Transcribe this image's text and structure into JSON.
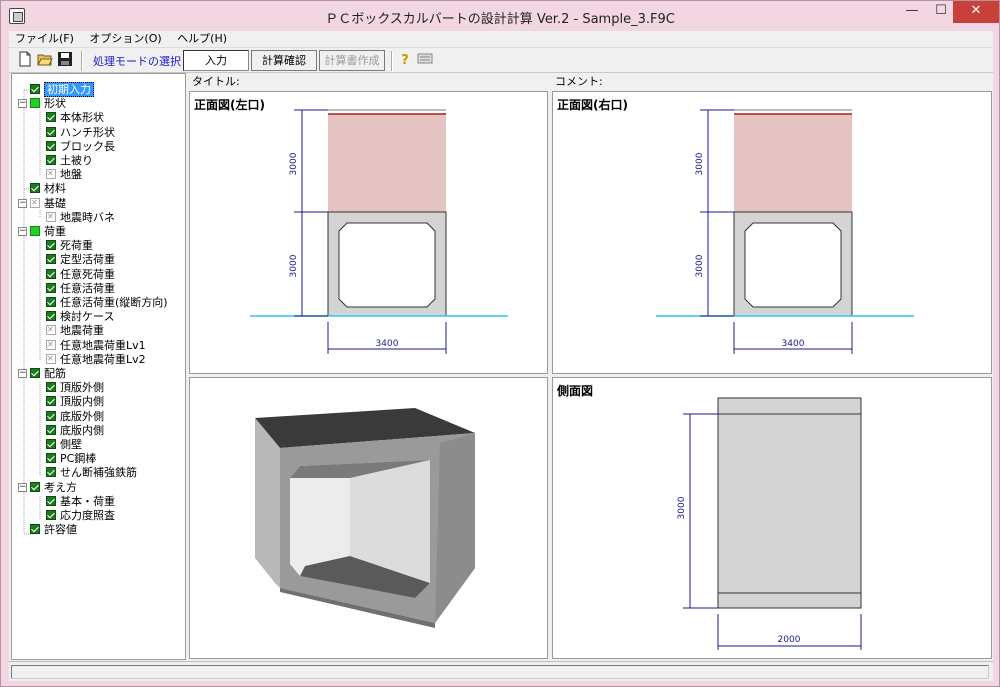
{
  "window": {
    "title": "ＰＣボックスカルバートの設計計算 Ver.2 - Sample_3.F9C",
    "min": "—",
    "max": "☐",
    "close": "✕"
  },
  "menu": [
    "ファイル(F)",
    "オプション(O)",
    "ヘルプ(H)"
  ],
  "toolbar": {
    "mode_label": "処理モードの選択",
    "input_btn": "入力",
    "calc_check_btn": "計算確認",
    "report_btn": "計算書作成",
    "help_glyph": "?"
  },
  "headers": {
    "title_label": "タイトル:",
    "comment_label": "コメント:"
  },
  "tree": [
    {
      "label": "初期入力",
      "state": "on",
      "level": 0,
      "selected": true
    },
    {
      "label": "形状",
      "state": "part",
      "level": 0,
      "expander": "−"
    },
    {
      "label": "本体形状",
      "state": "on",
      "level": 1
    },
    {
      "label": "ハンチ形状",
      "state": "on",
      "level": 1
    },
    {
      "label": "ブロック長",
      "state": "on",
      "level": 1
    },
    {
      "label": "土被り",
      "state": "on",
      "level": 1
    },
    {
      "label": "地盤",
      "state": "off",
      "level": 1
    },
    {
      "label": "材料",
      "state": "on",
      "level": 0
    },
    {
      "label": "基礎",
      "state": "off",
      "level": 0,
      "expander": "−"
    },
    {
      "label": "地震時バネ",
      "state": "off",
      "level": 1
    },
    {
      "label": "荷重",
      "state": "part",
      "level": 0,
      "expander": "−"
    },
    {
      "label": "死荷重",
      "state": "on",
      "level": 1
    },
    {
      "label": "定型活荷重",
      "state": "on",
      "level": 1
    },
    {
      "label": "任意死荷重",
      "state": "on",
      "level": 1
    },
    {
      "label": "任意活荷重",
      "state": "on",
      "level": 1
    },
    {
      "label": "任意活荷重(縦断方向)",
      "state": "on",
      "level": 1
    },
    {
      "label": "検討ケース",
      "state": "on",
      "level": 1
    },
    {
      "label": "地震荷重",
      "state": "off",
      "level": 1
    },
    {
      "label": "任意地震荷重Lv1",
      "state": "off",
      "level": 1
    },
    {
      "label": "任意地震荷重Lv2",
      "state": "off",
      "level": 1
    },
    {
      "label": "配筋",
      "state": "on",
      "level": 0,
      "expander": "−"
    },
    {
      "label": "頂版外側",
      "state": "on",
      "level": 1
    },
    {
      "label": "頂版内側",
      "state": "on",
      "level": 1
    },
    {
      "label": "底版外側",
      "state": "on",
      "level": 1
    },
    {
      "label": "底版内側",
      "state": "on",
      "level": 1
    },
    {
      "label": "側壁",
      "state": "on",
      "level": 1
    },
    {
      "label": "PC鋼棒",
      "state": "on",
      "level": 1
    },
    {
      "label": "せん断補強鉄筋",
      "state": "on",
      "level": 1
    },
    {
      "label": "考え方",
      "state": "on",
      "level": 0,
      "expander": "−"
    },
    {
      "label": "基本・荷重",
      "state": "on",
      "level": 1
    },
    {
      "label": "応力度照査",
      "state": "on",
      "level": 1
    },
    {
      "label": "許容値",
      "state": "on",
      "level": 0
    }
  ],
  "panes": {
    "front_left": {
      "title": "正面図(左口)",
      "dim_top": "3000",
      "dim_bottom": "3000",
      "dim_width": "3400"
    },
    "front_right": {
      "title": "正面図(右口)",
      "dim_top": "3000",
      "dim_bottom": "3000",
      "dim_width": "3400"
    },
    "side": {
      "title": "側面図",
      "dim_height": "3000",
      "dim_width": "2000"
    }
  },
  "colors": {
    "soil": "#e6c3c3",
    "water": "#2ec8e8",
    "dim_line": "#1a1a8c",
    "box_fill": "#d4d4d4"
  }
}
